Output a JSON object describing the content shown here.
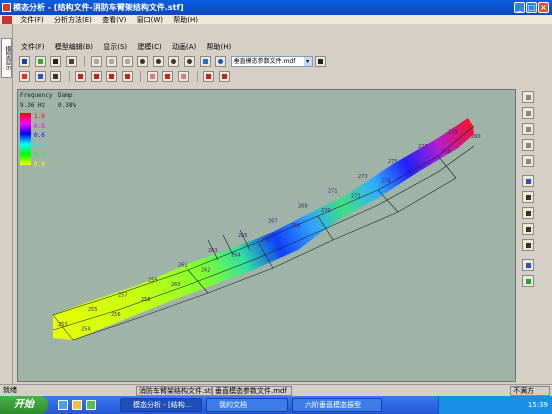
{
  "window": {
    "title": "模态分析 - [结构文件-消防车臂架结构文件.stf]",
    "min": "_",
    "max": "□",
    "close": "×"
  },
  "main_menu": [
    "文件(F)",
    "分析方法(E)",
    "查看(V)",
    "窗口(W)",
    "帮助(H)"
  ],
  "left_tab": "模型显示",
  "child_menu": [
    "文件(F)",
    "模型编辑(B)",
    "显示(S)",
    "建模(C)",
    "动画(A)",
    "帮助(H)"
  ],
  "file_select": {
    "value": "垂直模态参数文件.mdf"
  },
  "info": {
    "freq_label": "Frequency",
    "damp_label": "Damp",
    "freq_value": "9.36 Hz",
    "damp_value": "0.38%"
  },
  "legend": {
    "values": [
      "1.0",
      "0.8",
      "0.6",
      "0.4",
      "0.2",
      "0.0"
    ],
    "colors": [
      "#ff0000",
      "#ff00ff",
      "#0000ff",
      "#00ffff",
      "#00ff00",
      "#ffff00"
    ]
  },
  "nodes": [
    "253",
    "254",
    "255",
    "256",
    "257",
    "258",
    "259",
    "260",
    "261",
    "262",
    "263",
    "264",
    "265",
    "266",
    "267",
    "268",
    "269",
    "270",
    "271",
    "272",
    "273",
    "274",
    "275",
    "276",
    "277",
    "278",
    "279",
    "280"
  ],
  "status": {
    "ready": "就绪",
    "file1": "消防车臂架结构文件.stf",
    "file2": "垂直模态参数文件.mdf",
    "mode": "不满方"
  },
  "taskbar": {
    "start": "开始",
    "tasks": [
      "模态分析 - [结构...",
      "我的文档",
      "六阶垂直模态振型"
    ],
    "clock": "15:39"
  }
}
